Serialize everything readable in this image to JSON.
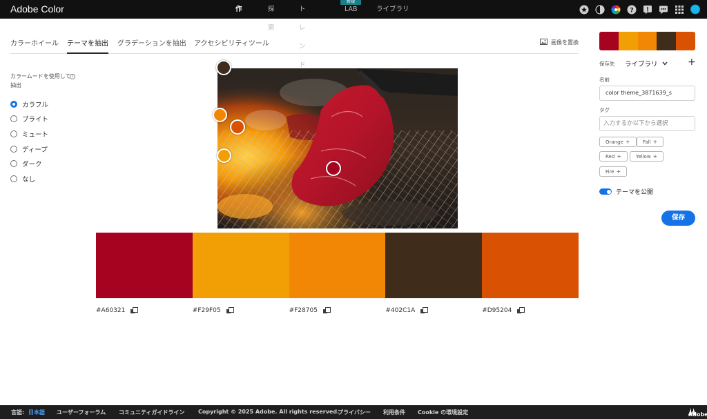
{
  "app": {
    "brand": "Adobe Color"
  },
  "nav": {
    "items": [
      {
        "label": "作成"
      },
      {
        "label": "探索"
      },
      {
        "label": "トレンド"
      },
      {
        "label": "LAB"
      },
      {
        "label": "ライブラリ"
      }
    ],
    "new_badge": "新規"
  },
  "top_icons": [
    "star-icon",
    "contrast-icon",
    "color-wheel-icon",
    "help-icon",
    "alert-icon",
    "feedback-icon",
    "apps-grid-icon",
    "profile-avatar"
  ],
  "tabs": [
    {
      "label": "カラーホイール"
    },
    {
      "label": "テーマを抽出"
    },
    {
      "label": "グラデーションを抽出"
    },
    {
      "label": "アクセシビリティツール"
    }
  ],
  "replace_image": {
    "label": "画像を置換"
  },
  "mode": {
    "title": "カラームードを使用して抽出",
    "options": [
      {
        "label": "カラフル",
        "selected": true
      },
      {
        "label": "ブライト",
        "selected": false
      },
      {
        "label": "ミュート",
        "selected": false
      },
      {
        "label": "ディープ",
        "selected": false
      },
      {
        "label": "ダーク",
        "selected": false
      },
      {
        "label": "なし",
        "selected": false
      }
    ]
  },
  "palette": [
    {
      "hex": "#A60321",
      "color": "#A60321"
    },
    {
      "hex": "#F29F05",
      "color": "#F29F05"
    },
    {
      "hex": "#F28705",
      "color": "#F28705"
    },
    {
      "hex": "#402C1A",
      "color": "#402C1A"
    },
    {
      "hex": "#D95204",
      "color": "#D95204"
    }
  ],
  "side": {
    "save_to_label": "保存先",
    "library": "ライブラリ",
    "name_label": "名前",
    "name_value": "color theme_3871639_s",
    "tag_label": "タグ",
    "tag_placeholder": "入力するか以下から選択",
    "tags": [
      "Orange",
      "Fall",
      "Red",
      "Yellow",
      "Fire"
    ],
    "publish_label": "テーマを公開",
    "save_button": "保存"
  },
  "footer": {
    "language_label": "言語:",
    "language_value": "日本語",
    "user_forum": "ユーザーフォーラム",
    "community": "コミュニティガイドライン",
    "copyright": "Copyright © 2025 Adobe. All rights reserved.",
    "privacy": "プライバシー",
    "terms": "利用条件",
    "cookie": "Cookie の環境設定",
    "adobe": "Adobe"
  }
}
